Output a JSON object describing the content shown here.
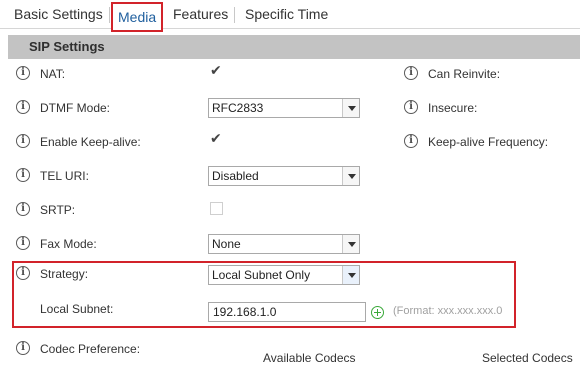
{
  "tabs": {
    "basic": "Basic Settings",
    "media": "Media",
    "features": "Features",
    "specific_time": "Specific Time"
  },
  "section": {
    "title": "SIP Settings"
  },
  "fields": {
    "nat": {
      "label": "NAT:",
      "checked": true
    },
    "dtmf_mode": {
      "label": "DTMF Mode:",
      "value": "RFC2833"
    },
    "keep_alive": {
      "label": "Enable Keep-alive:",
      "checked": true
    },
    "tel_uri": {
      "label": "TEL URI:",
      "value": "Disabled"
    },
    "srtp": {
      "label": "SRTP:",
      "checked": false
    },
    "fax_mode": {
      "label": "Fax Mode:",
      "value": "None"
    },
    "strategy": {
      "label": "Strategy:",
      "value": "Local Subnet Only"
    },
    "local_subnet": {
      "label": "Local Subnet:",
      "value": "192.168.1.0",
      "hint": "(Format: xxx.xxx.xxx.0"
    },
    "codec_preference": {
      "label": "Codec Preference:"
    }
  },
  "right_fields": {
    "can_reinvite": "Can Reinvite:",
    "insecure": "Insecure:",
    "keep_alive_frequency": "Keep-alive Frequency:"
  },
  "codecs": {
    "available": "Available Codecs",
    "selected": "Selected Codecs"
  },
  "icons": {
    "info": "info-icon",
    "add": "plus-circle-icon",
    "check": "checkmark-icon",
    "dropdown": "chevron-down-icon"
  },
  "colors": {
    "highlight": "#d2232a",
    "section_bg": "#c3c3c3",
    "active_tab_text": "#1f5f9e",
    "add_icon": "#3aa93a"
  }
}
